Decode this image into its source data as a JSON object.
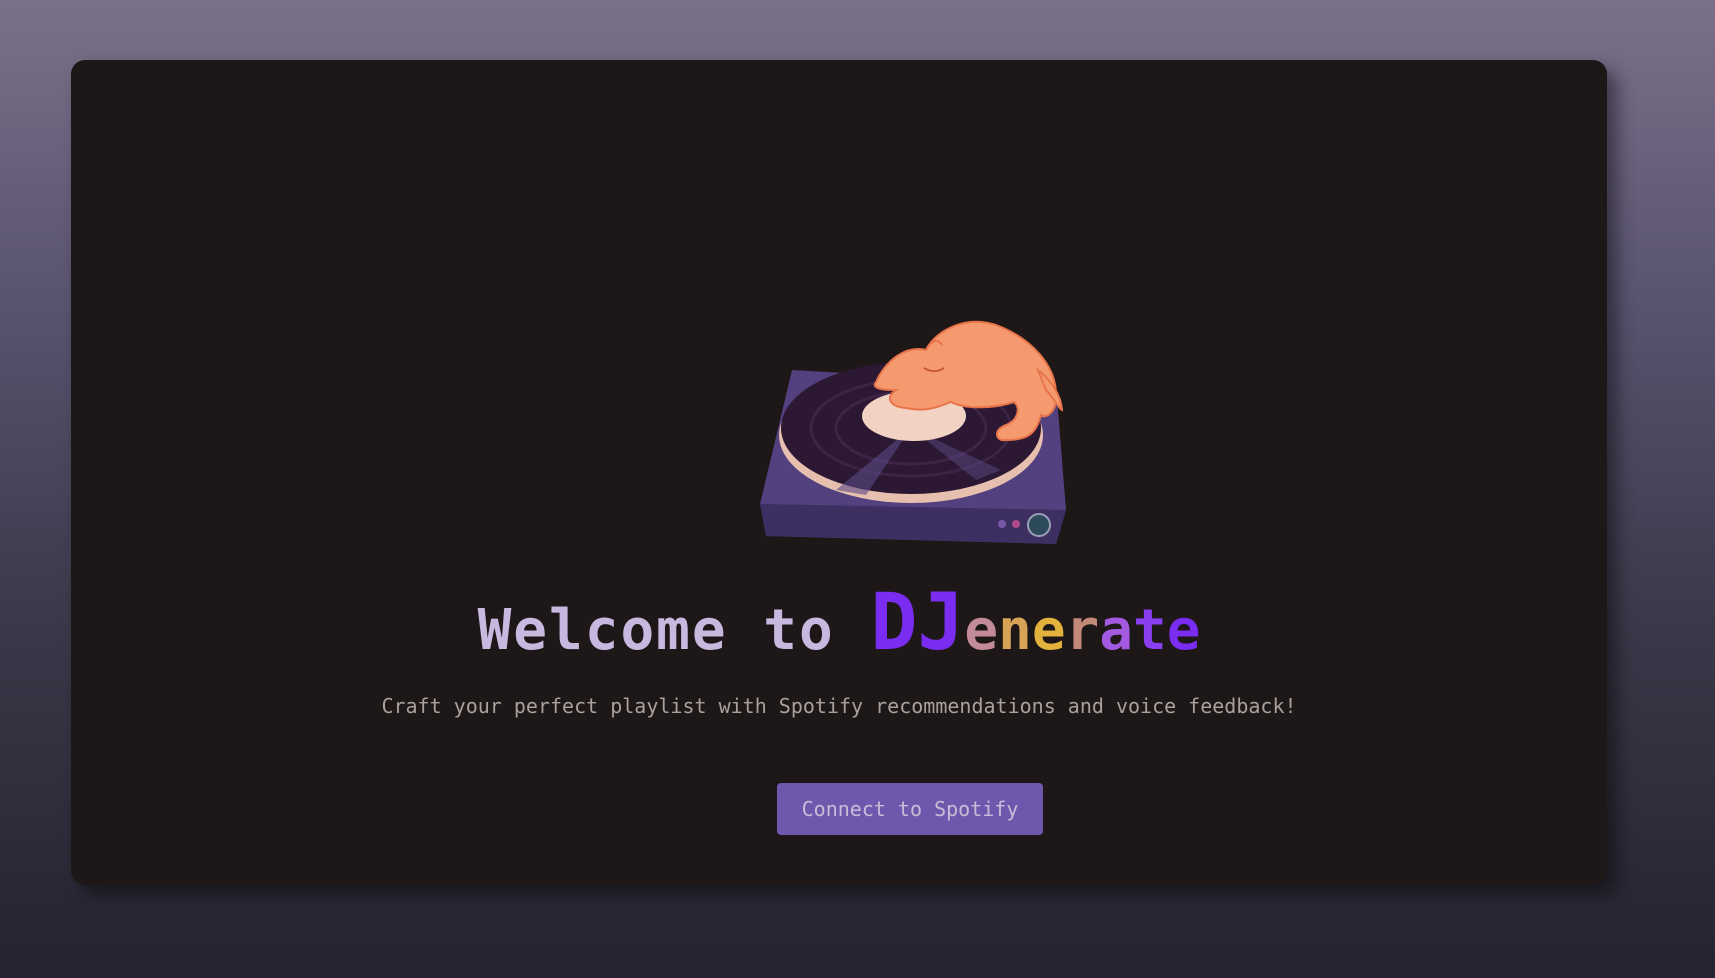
{
  "header": {
    "welcome": "Welcome to ",
    "brand_dj": "DJ",
    "brand_rest": [
      {
        "char": "e",
        "color": "#c38a9a"
      },
      {
        "char": "n",
        "color": "#d6a357"
      },
      {
        "char": "e",
        "color": "#e2b23c"
      },
      {
        "char": "r",
        "color": "#c38a7a"
      },
      {
        "char": "a",
        "color": "#a35ae0"
      },
      {
        "char": "t",
        "color": "#8a3ef0"
      },
      {
        "char": "e",
        "color": "#7a2cf0"
      }
    ]
  },
  "subtitle": "Craft your perfect playlist with Spotify recommendations and voice feedback!",
  "connect_button": {
    "label": "Connect to Spotify"
  },
  "illustration": {
    "icon": "cat-on-turntable-icon"
  },
  "colors": {
    "accent": "#6e57ad",
    "brand_purple": "#7a2cf0",
    "card_bg": "#1d1717"
  }
}
